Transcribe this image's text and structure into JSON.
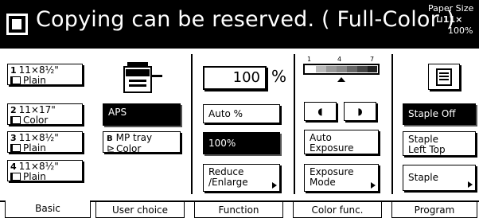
{
  "header": {
    "message": "Copying can be reserved. ( Full-Color )",
    "paper_size_label": "Paper Size",
    "paper_size_value": "11×",
    "zoom": "100%"
  },
  "trays": [
    {
      "num": "1",
      "size": "11×8½\"",
      "type": "Plain"
    },
    {
      "num": "2",
      "size": "11×17\"",
      "type": "Color"
    },
    {
      "num": "3",
      "size": "11×8½\"",
      "type": "Plain"
    },
    {
      "num": "4",
      "size": "11×8½\"",
      "type": "Plain"
    }
  ],
  "paper": {
    "aps_label": "APS",
    "mp_tray_letter": "B",
    "mp_tray_label": "MP tray",
    "mp_tray_type": "Color"
  },
  "zoom": {
    "value": "100",
    "unit": "%",
    "auto_label": "Auto %",
    "full_label": "100%",
    "reduce_label_1": "Reduce",
    "reduce_label_2": "/Enlarge"
  },
  "exposure": {
    "scale_1": "1",
    "scale_4": "4",
    "scale_7": "7",
    "auto_label_1": "Auto",
    "auto_label_2": "Exposure",
    "mode_label_1": "Exposure",
    "mode_label_2": "Mode"
  },
  "finishing": {
    "staple_off": "Staple Off",
    "staple_left_1": "Staple",
    "staple_left_2": "Left Top",
    "staple": "Staple"
  },
  "tabs": [
    "Basic",
    "User choice",
    "Function",
    "Color func.",
    "Program"
  ]
}
